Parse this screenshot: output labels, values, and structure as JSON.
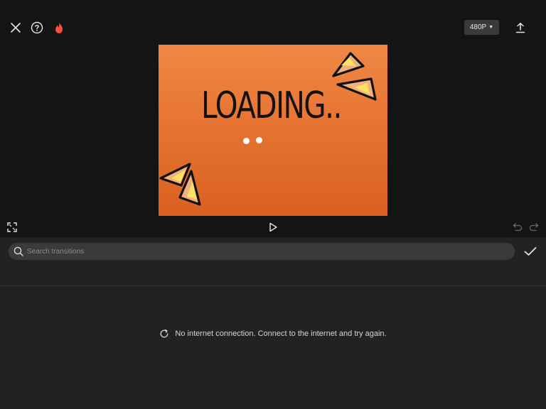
{
  "header": {
    "resolution_label": "480P",
    "icons": [
      "close-icon",
      "help-icon",
      "fire-icon",
      "export-icon"
    ]
  },
  "preview": {
    "loading_text": "LOADING..",
    "background_color": "#e77432"
  },
  "controls": {
    "icons": [
      "fullscreen-icon",
      "play-icon",
      "undo-icon",
      "redo-icon"
    ]
  },
  "search": {
    "placeholder": "Search transitions",
    "value": ""
  },
  "status": {
    "message": "No internet connection. Connect to the internet and try again."
  },
  "colors": {
    "accent_fire": "#ff4d3a",
    "panel": "#222222",
    "background": "#141414"
  }
}
